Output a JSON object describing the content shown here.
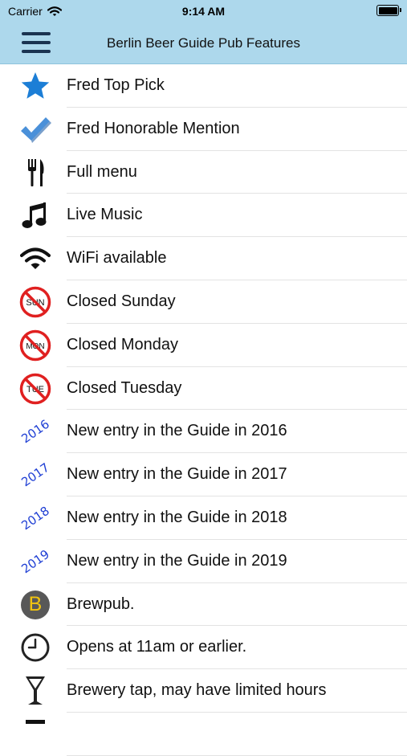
{
  "status_bar": {
    "carrier": "Carrier",
    "time": "9:14 AM",
    "battery_level": 1.0
  },
  "nav": {
    "title": "Berlin Beer Guide Pub Features"
  },
  "features": [
    {
      "icon": "star-icon",
      "label": "Fred Top Pick"
    },
    {
      "icon": "checkmark-icon",
      "label": "Fred Honorable Mention"
    },
    {
      "icon": "fork-knife-icon",
      "label": "Full menu"
    },
    {
      "icon": "music-note-icon",
      "label": "Live Music"
    },
    {
      "icon": "wifi-icon",
      "label": "WiFi available"
    },
    {
      "icon": "no-sunday-icon",
      "icon_text": "SUN",
      "label": "Closed Sunday"
    },
    {
      "icon": "no-monday-icon",
      "icon_text": "MON",
      "label": "Closed Monday"
    },
    {
      "icon": "no-tuesday-icon",
      "icon_text": "TUE",
      "label": "Closed Tuesday"
    },
    {
      "icon": "year-2016-icon",
      "icon_text": "2016",
      "label": "New entry in the Guide in 2016"
    },
    {
      "icon": "year-2017-icon",
      "icon_text": "2017",
      "label": "New entry in the Guide in 2017"
    },
    {
      "icon": "year-2018-icon",
      "icon_text": "2018",
      "label": "New entry in the Guide in 2018"
    },
    {
      "icon": "year-2019-icon",
      "icon_text": "2019",
      "label": "New entry in the Guide in 2019"
    },
    {
      "icon": "brewpub-icon",
      "icon_text": "B",
      "label": "Brewpub."
    },
    {
      "icon": "clock-icon",
      "label": "Opens at 11am or earlier."
    },
    {
      "icon": "wine-glass-icon",
      "label": "Brewery tap, may have limited hours"
    }
  ]
}
